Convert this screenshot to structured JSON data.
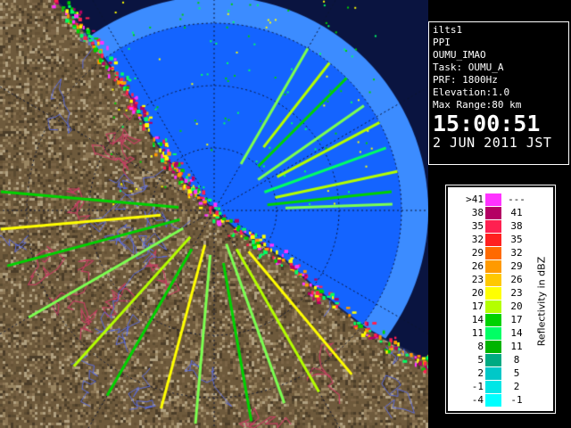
{
  "info": {
    "site": "ilts1",
    "scan_mode": "PPI",
    "station": "OUMU_IMAO",
    "task": "Task: OUMU_A",
    "prf": "PRF: 1800Hz",
    "elevation": "Elevation:1.0",
    "max_range": "Max Range:80 km",
    "time": "15:00:51",
    "date": "2 JUN 2011 JST"
  },
  "legend": {
    "title": "Reflectivity in dBZ",
    "rows": [
      {
        "low": ">41",
        "high": "---",
        "color": "#ff33ff"
      },
      {
        "low": "38",
        "high": "41",
        "color": "#b40064"
      },
      {
        "low": "35",
        "high": "38",
        "color": "#ff2050"
      },
      {
        "low": "32",
        "high": "35",
        "color": "#ff2020"
      },
      {
        "low": "29",
        "high": "32",
        "color": "#ff6a00"
      },
      {
        "low": "26",
        "high": "29",
        "color": "#ff9a00"
      },
      {
        "low": "23",
        "high": "26",
        "color": "#ffc800"
      },
      {
        "low": "20",
        "high": "23",
        "color": "#ffff00"
      },
      {
        "low": "17",
        "high": "20",
        "color": "#b4ff00"
      },
      {
        "low": "14",
        "high": "17",
        "color": "#00d200"
      },
      {
        "low": "11",
        "high": "14",
        "color": "#00ff64"
      },
      {
        "low": "8",
        "high": "11",
        "color": "#00b400"
      },
      {
        "low": "5",
        "high": "8",
        "color": "#00aa82"
      },
      {
        "low": "2",
        "high": "5",
        "color": "#00c8c8"
      },
      {
        "low": "-1",
        "high": "2",
        "color": "#00e6e6"
      },
      {
        "low": "-4",
        "high": "-1",
        "color": "#00ffff"
      }
    ]
  },
  "colors": {
    "sea": "#1464ff",
    "outer_ring": "#3c8cff",
    "coast": "#1e2850",
    "rings": "#0a1432"
  },
  "icons": {
    "radar": "radar-ppi-map-icon"
  }
}
